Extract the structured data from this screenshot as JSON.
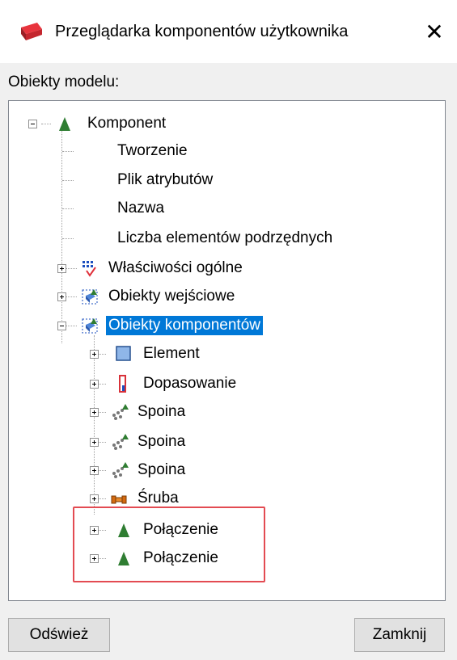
{
  "window": {
    "title": "Przeglądarka komponentów użytkownika",
    "close_glyph": "✕"
  },
  "section_label": "Obiekty modelu:",
  "tree": {
    "root": "Komponent",
    "properties": [
      "Tworzenie",
      "Plik atrybutów",
      "Nazwa",
      "Liczba elementów podrzędnych"
    ],
    "groups": [
      "Właściwości ogólne",
      "Obiekty wejściowe",
      "Obiekty komponentów"
    ],
    "children": [
      "Element",
      "Dopasowanie",
      "Spoina",
      "Spoina",
      "Spoina",
      "Śruba",
      "Połączenie",
      "Połączenie"
    ]
  },
  "buttons": {
    "refresh": "Odśwież",
    "close": "Zamknij"
  },
  "colors": {
    "selection": "#0078d7",
    "highlight_border": "#e34b52"
  },
  "icons": [
    "window-app-icon",
    "close-icon",
    "expander-icon",
    "component-icon",
    "general-properties-icon",
    "input-objects-icon",
    "component-objects-icon",
    "part-icon",
    "fitting-icon",
    "weld-icon",
    "bolt-icon",
    "connection-icon"
  ]
}
